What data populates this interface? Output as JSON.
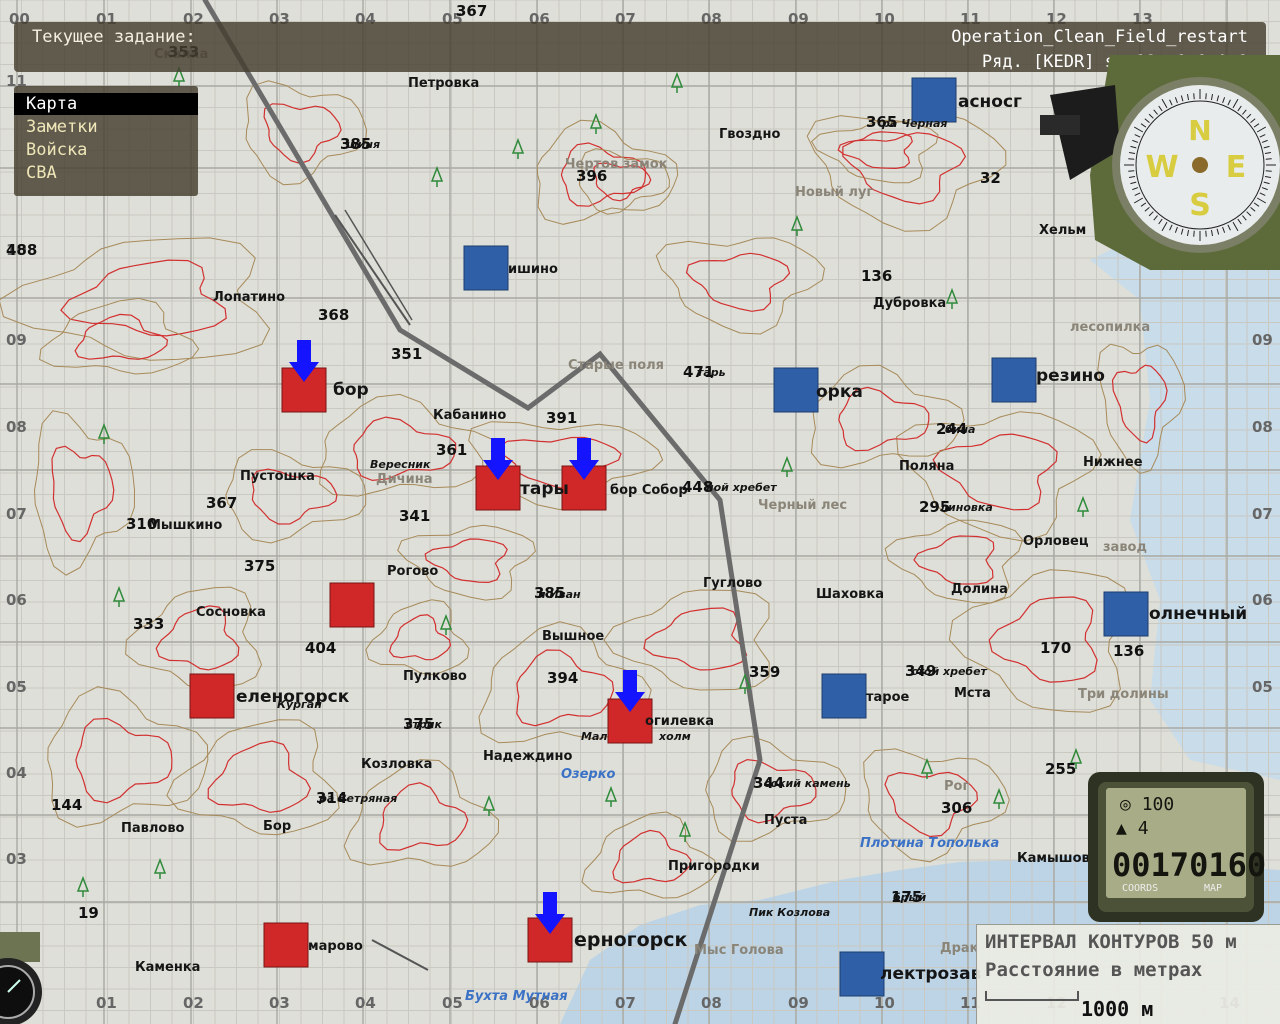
{
  "header": {
    "task_label": "Текущее задание:",
    "mission_name": "Operation_Clean_Field_restart",
    "unit_info": "Ряд. [KEDR] ss 18, 1-1-A 1"
  },
  "menu": [
    {
      "label": "Карта",
      "active": true
    },
    {
      "label": "Заметки",
      "active": false
    },
    {
      "label": "Войска",
      "active": false
    },
    {
      "label": "CBA",
      "active": false
    }
  ],
  "grid_labels": {
    "top": [
      "00",
      "01",
      "02",
      "03",
      "04",
      "05",
      "06",
      "07",
      "08",
      "09",
      "10",
      "11",
      "12",
      "13"
    ],
    "bottom": [
      "01",
      "02",
      "03",
      "04",
      "05",
      "06",
      "07",
      "08",
      "09",
      "10",
      "11",
      "12",
      "14"
    ],
    "left": [
      "11",
      "10",
      "09",
      "08",
      "07",
      "06",
      "05",
      "04",
      "03"
    ],
    "right": [
      "09",
      "08",
      "07",
      "06",
      "05"
    ]
  },
  "towns": [
    "Петровка",
    "Гвоздно",
    "Чертов замок",
    "Новый луг",
    "Хельм",
    "ишино",
    "Лопатино",
    "Дубровка",
    "лесопилка",
    "бор",
    "Кабанино",
    "Старые поля",
    "орка",
    "резино",
    "Вересник",
    "Дичина",
    "Пустошка",
    "тары",
    "бор Собор",
    "Черный лес",
    "ной хребет",
    "Поляна",
    "Нижнее",
    "Мышкино",
    "линовка",
    "Орловец",
    "завод",
    "Рогово",
    "Гуглово",
    "Шаховка",
    "Долина",
    "Сосновка",
    "Вышное",
    "олнечный",
    "п Иван",
    "Пулково",
    "стой хребет",
    "Мста",
    "Три долины",
    "еленогорск",
    "Курган",
    "Надеждино",
    "огилевка",
    "холм",
    "стрик",
    "Мал",
    "тарое",
    "Козловка",
    "Озерко",
    "сокий камень",
    "Рог",
    "Павлово",
    "Бор",
    "ра Ветряная",
    "Пуста",
    "Плотина Тополька",
    "Камышово",
    "Пригородки",
    "брый",
    "Пик Козлова",
    "Мыс Голова",
    "Драк",
    "Каменка",
    "марово",
    "ерногорск",
    "Бухта Мутная",
    "лектрозав",
    "Скалка",
    "асносг",
    "ра Черная",
    "шиня",
    "тарь",
    "бина"
  ],
  "heights": [
    "367",
    "353",
    "365",
    "385",
    "396",
    "32",
    "488",
    "136",
    "368",
    "351",
    "471",
    "391",
    "361",
    "244",
    "448",
    "367",
    "310",
    "341",
    "295",
    "375",
    "385",
    "333",
    "404",
    "359",
    "170",
    "136",
    "394",
    "349",
    "375",
    "144",
    "314",
    "344",
    "255",
    "306",
    "19",
    "175"
  ],
  "legend": {
    "contour_interval": "ИНТЕРВАЛ КОНТУРОВ 50 м",
    "distance_label": "Расстояние в метрах",
    "scale_value": "1000 м"
  },
  "gps": {
    "heading": "100",
    "altitude": "4",
    "coords": "00170160",
    "btn_coords": "COORDS",
    "btn_map": "MAP"
  },
  "compass": {
    "n": "N",
    "w": "W",
    "e": "E",
    "s": "S"
  },
  "colors": {
    "friendly": "#2f5fa6",
    "enemy": "#d02828",
    "waypoint": "#1414ff",
    "contour_red": "#d23030",
    "contour_brown": "#a78a5a"
  }
}
